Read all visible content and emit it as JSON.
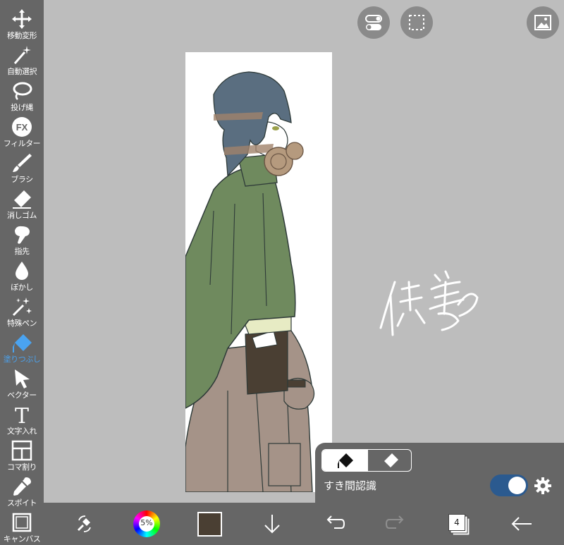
{
  "toolbar": {
    "tools": [
      {
        "label": "移動変形",
        "icon": "move-transform-icon"
      },
      {
        "label": "自動選択",
        "icon": "magic-wand-icon"
      },
      {
        "label": "投げ縄",
        "icon": "lasso-icon"
      },
      {
        "label": "フィルター",
        "icon": "fx-filter-icon",
        "icon_text": "FX"
      },
      {
        "label": "ブラシ",
        "icon": "brush-icon"
      },
      {
        "label": "消しゴム",
        "icon": "eraser-icon"
      },
      {
        "label": "指先",
        "icon": "finger-smudge-icon"
      },
      {
        "label": "ぼかし",
        "icon": "blur-drop-icon"
      },
      {
        "label": "特殊ペン",
        "icon": "special-pen-icon"
      },
      {
        "label": "塗りつぶし",
        "icon": "bucket-fill-icon"
      },
      {
        "label": "ベクター",
        "icon": "vector-arrow-icon"
      },
      {
        "label": "文字入れ",
        "icon": "text-icon",
        "icon_text": "T"
      },
      {
        "label": "コマ割り",
        "icon": "frame-divider-icon"
      },
      {
        "label": "スポイト",
        "icon": "eyedropper-icon"
      },
      {
        "label": "キャンバス",
        "icon": "canvas-icon"
      }
    ],
    "active_index": 9,
    "active_color": "#4aa3f0"
  },
  "top_buttons": {
    "toggle_view": "toggle-switch-icon",
    "selection": "dashed-selection-icon",
    "reference": "image-icon"
  },
  "canvas": {
    "signature_text": "供養"
  },
  "fill_panel": {
    "mode_fill_icon": "bucket-fill-icon",
    "mode_erase_icon": "eraser-icon",
    "gap_label": "すき間認識",
    "gap_toggle_on": true,
    "toggle_color": "#2b5a8f"
  },
  "bottombar": {
    "brush_opacity": "5%",
    "current_color": "#4a3f33",
    "layer_count": "4"
  }
}
